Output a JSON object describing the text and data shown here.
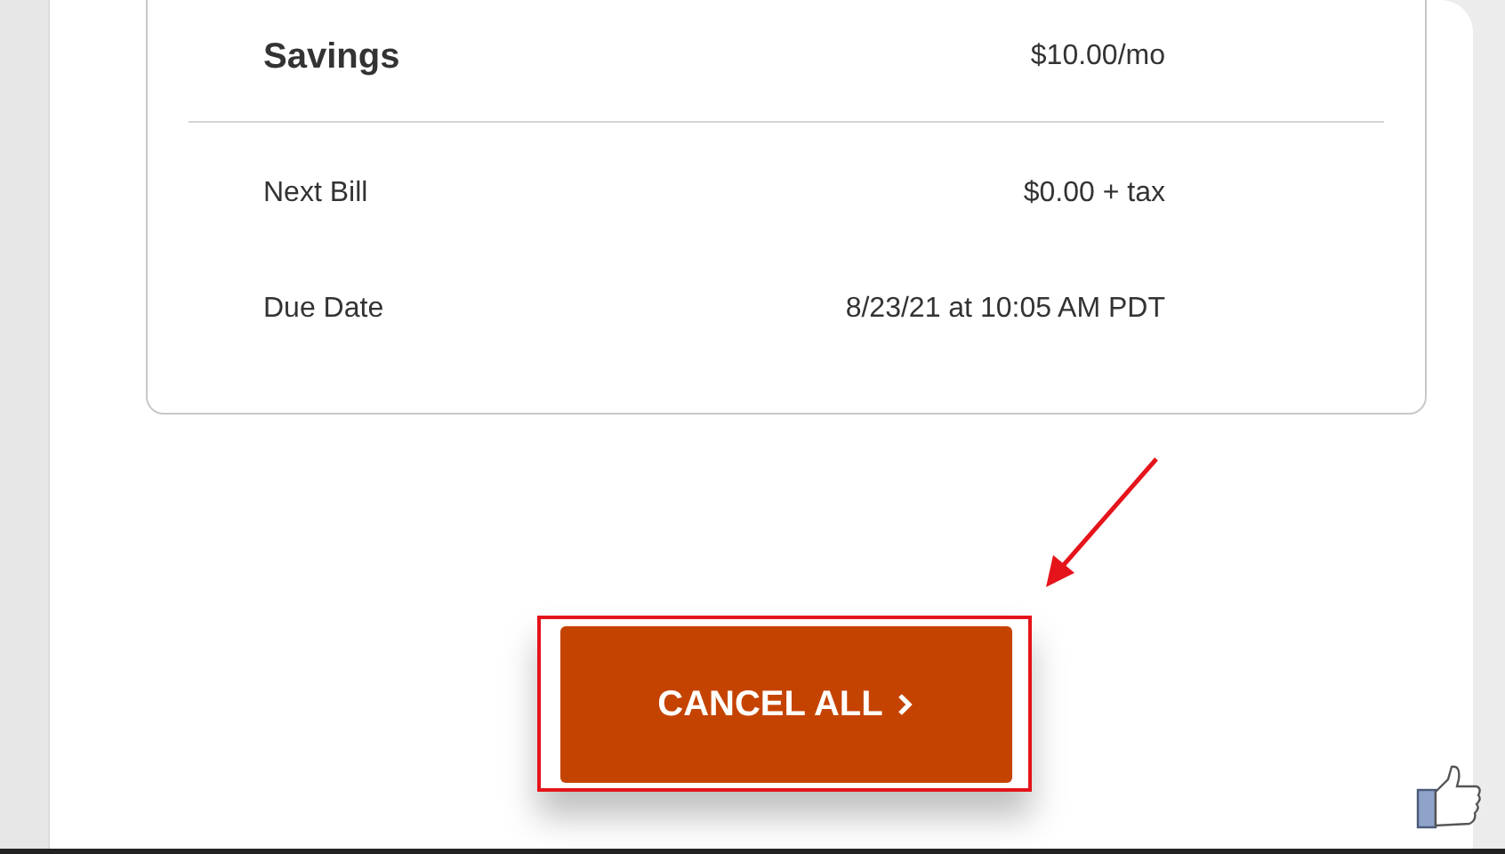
{
  "summary": {
    "title": "Savings",
    "value": "$10.00/mo"
  },
  "details": [
    {
      "label": "Next Bill",
      "value": "$0.00 + tax"
    },
    {
      "label": "Due Date",
      "value": "8/23/21 at 10:05 AM PDT"
    }
  ],
  "cancel_button": {
    "label": "CANCEL ALL"
  }
}
